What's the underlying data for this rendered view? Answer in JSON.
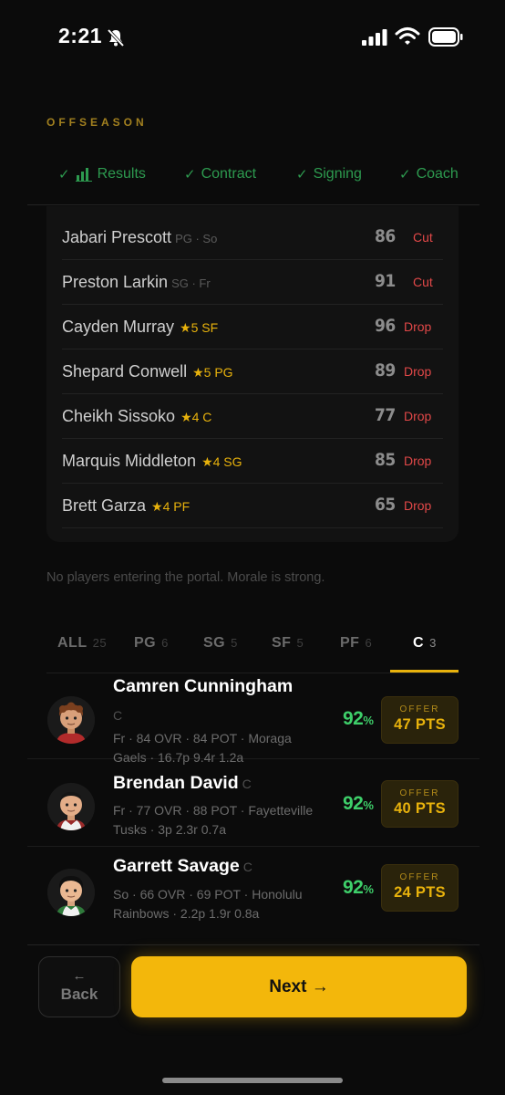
{
  "status_bar": {
    "time": "2:21"
  },
  "section_label": "OFFSEASON",
  "steps": [
    {
      "label": "Results",
      "has_icon": true
    },
    {
      "label": "Contract"
    },
    {
      "label": "Signing"
    },
    {
      "label": "Coach"
    }
  ],
  "step_check": "✓",
  "roster": [
    {
      "name": "Jabari Prescott",
      "meta": "PG · So",
      "stars": "",
      "ovr": "86",
      "action": "Cut"
    },
    {
      "name": "Preston Larkin",
      "meta": "SG · Fr",
      "stars": "",
      "ovr": "91",
      "action": "Cut"
    },
    {
      "name": "Cayden Murray",
      "meta": "",
      "stars": "★5 SF",
      "ovr": "96",
      "action": "Drop"
    },
    {
      "name": "Shepard Conwell",
      "meta": "",
      "stars": "★5 PG",
      "ovr": "89",
      "action": "Drop"
    },
    {
      "name": "Cheikh Sissoko",
      "meta": "",
      "stars": "★4 C",
      "ovr": "77",
      "action": "Drop"
    },
    {
      "name": "Marquis Middleton",
      "meta": "",
      "stars": "★4 SG",
      "ovr": "85",
      "action": "Drop"
    },
    {
      "name": "Brett Garza",
      "meta": "",
      "stars": "★4 PF",
      "ovr": "65",
      "action": "Drop"
    }
  ],
  "portal_message": "No players entering the portal. Morale is strong.",
  "position_tabs": [
    {
      "label": "ALL",
      "count": "25"
    },
    {
      "label": "PG",
      "count": "6"
    },
    {
      "label": "SG",
      "count": "5"
    },
    {
      "label": "SF",
      "count": "5"
    },
    {
      "label": "PF",
      "count": "6"
    },
    {
      "label": "C",
      "count": "3",
      "active": true
    }
  ],
  "recruits": [
    {
      "name": "Camren Cunningham",
      "pos": "C",
      "info": "Fr · 84 OVR · 84 POT · Moraga Gaels · 16.7p 9.4r 1.2a",
      "pct": "92",
      "pct_sign": "%",
      "offer_label": "OFFER",
      "offer_value": "47 PTS"
    },
    {
      "name": "Brendan David",
      "pos": "C",
      "info": "Fr · 77 OVR · 88 POT · Fayetteville Tusks · 3p 2.3r 0.7a",
      "pct": "92",
      "pct_sign": "%",
      "offer_label": "OFFER",
      "offer_value": "40 PTS"
    },
    {
      "name": "Garrett Savage",
      "pos": "C",
      "info": "So · 66 OVR · 69 POT · Honolulu Rainbows · 2.2p 1.9r 0.8a",
      "pct": "92",
      "pct_sign": "%",
      "offer_label": "OFFER",
      "offer_value": "24 PTS"
    }
  ],
  "footer": {
    "back_arrow": "←",
    "back_label": "Back",
    "next_label": "Next →"
  },
  "colors": {
    "accent": "#f3b70b",
    "success": "#2d9a4f",
    "danger": "#e14848",
    "percent": "#3ecf6a"
  }
}
